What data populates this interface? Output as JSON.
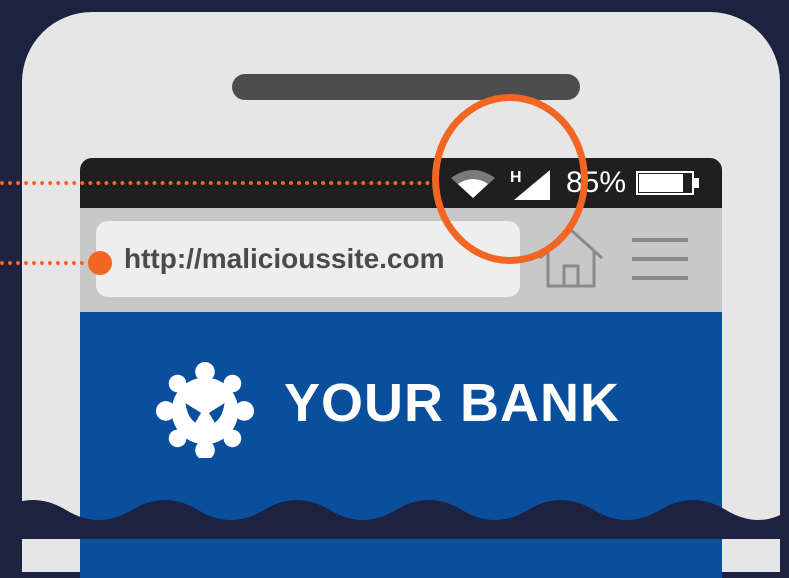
{
  "status_bar": {
    "network_type": "H",
    "battery_percent": "85%",
    "battery_level": 0.85,
    "icons": [
      "wifi-icon",
      "cellular-signal-icon",
      "battery-icon"
    ]
  },
  "browser": {
    "url": "http://malicioussite.com",
    "icons": [
      "home-icon",
      "hamburger-menu-icon"
    ]
  },
  "page": {
    "bank_name": "YOUR BANK",
    "logo_icon": "bank-logo-icon"
  },
  "colors": {
    "background": "#1d2240",
    "phone_body": "#e6e6e6",
    "status_bar": "#1f1f1f",
    "bank_blue": "#0a4f9e",
    "highlight": "#f26522"
  }
}
